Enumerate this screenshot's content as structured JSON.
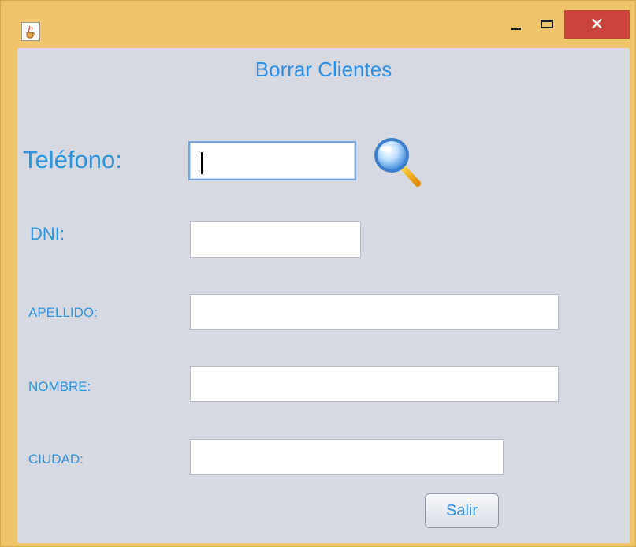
{
  "window": {
    "title": "",
    "close_label": "✕"
  },
  "form": {
    "title": "Borrar Clientes",
    "telefono": {
      "label": "Teléfono:",
      "value": ""
    },
    "dni": {
      "label": "DNI:",
      "value": ""
    },
    "apellido": {
      "label": "APELLIDO:",
      "value": ""
    },
    "nombre": {
      "label": "NOMBRE:",
      "value": ""
    },
    "ciudad": {
      "label": "CIUDAD:",
      "value": ""
    },
    "salir_label": "Salir"
  },
  "icons": {
    "app": "java-cup-icon",
    "search": "magnifier-icon"
  },
  "colors": {
    "titlebar": "#f0c46a",
    "close": "#c9453c",
    "label": "#2f95dc",
    "background": "#d6d9e1"
  }
}
